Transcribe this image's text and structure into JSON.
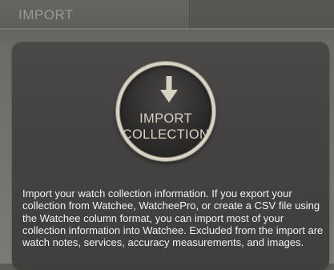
{
  "header": {
    "title": "IMPORT"
  },
  "import_button": {
    "icon": "arrow-down-icon",
    "label_line1": "IMPORT",
    "label_line2": "COLLECTION"
  },
  "description": "Import your watch collection information. If you export your collection from Watchee, WatcheePro, or create a CSV file using the Watchee column format, you can import most of your collection information into Watchee. Excluded from the import are watch notes, services, accuracy measurements, and images.",
  "colors": {
    "background": "#6d6b67",
    "panel": "#444341",
    "button_face": "#2c2b2a",
    "button_ring": "#d8d3c4",
    "button_text": "#d6d1c1",
    "title_text": "#9a9894",
    "body_text": "#f2f2f0"
  }
}
